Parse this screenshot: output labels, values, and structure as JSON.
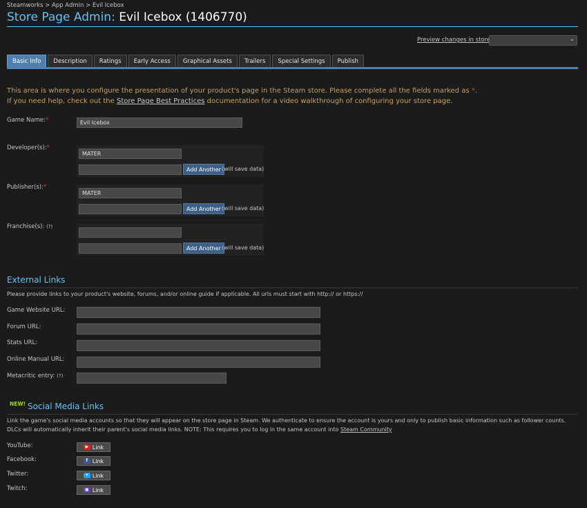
{
  "breadcrumb": "Steamworks > App Admin > Evil Icebox",
  "header": {
    "title_prefix": "Store Page Admin:",
    "title_game": "Evil Icebox (1406770)"
  },
  "preview": {
    "label": "Preview changes in store",
    "selected": ""
  },
  "tabs": [
    {
      "label": "Basic Info",
      "active": true
    },
    {
      "label": "Description"
    },
    {
      "label": "Ratings"
    },
    {
      "label": "Early Access"
    },
    {
      "label": "Graphical Assets"
    },
    {
      "label": "Trailers"
    },
    {
      "label": "Special Settings"
    },
    {
      "label": "Publish"
    }
  ],
  "intro": {
    "line1_text": "This area is where you configure the presentation of your product's page in the Steam store. Please complete all the fields marked as",
    "star": "*",
    "line1_end": ".",
    "line2_pre": "If you need help, check out the",
    "line2_link": "Store Page Best Practices",
    "line2_post": "documentation for a video walkthrough of configuring your store page."
  },
  "basic": {
    "game_name_label": "Game Name:",
    "game_name_value": "Evil Icebox",
    "required_star": "*",
    "developers_label": "Developer(s):",
    "developer_value": "MATER",
    "publishers_label": "Publisher(s):",
    "publisher_value": "MATER",
    "franchise_label": "Franchise(s):",
    "help_mark": "(?)",
    "add_another": "Add Another",
    "will_save": "(will save data)"
  },
  "external_links": {
    "title": "External Links",
    "description": "Please provide links to your product's website, forums, and/or online guide if applicable. All urls must start with http:// or https://",
    "website_label": "Game Website URL:",
    "forum_label": "Forum URL:",
    "stats_label": "Stats URL:",
    "manual_label": "Online Manual URL:",
    "metacritic_label": "Metacritic entry:"
  },
  "social": {
    "badge": "NEW!",
    "title": "Social Media Links",
    "description_pre": "Link the game's social media accounts so that they will appear on the store page in Steam. We authenticate to ensure the account is yours and only to publish basic information such as follower counts. DLCs will automatically inherit their parent's social media links. NOTE: This requires you to log in the same account into",
    "description_link": "Steam Community",
    "link_label": "Link",
    "youtube_label": "YouTube:",
    "facebook_label": "Facebook:",
    "twitter_label": "Twitter:",
    "twitch_label": "Twitch:",
    "youtube_glyph": "▶",
    "facebook_glyph": "f",
    "twitter_glyph": "✦",
    "twitch_glyph": "▣"
  },
  "colors": {
    "accent": "#67c1f5",
    "tab_active": "#4e7fae",
    "intro_text": "#c8a15a",
    "required": "#e03c3c",
    "new_badge": "#a4d007"
  }
}
